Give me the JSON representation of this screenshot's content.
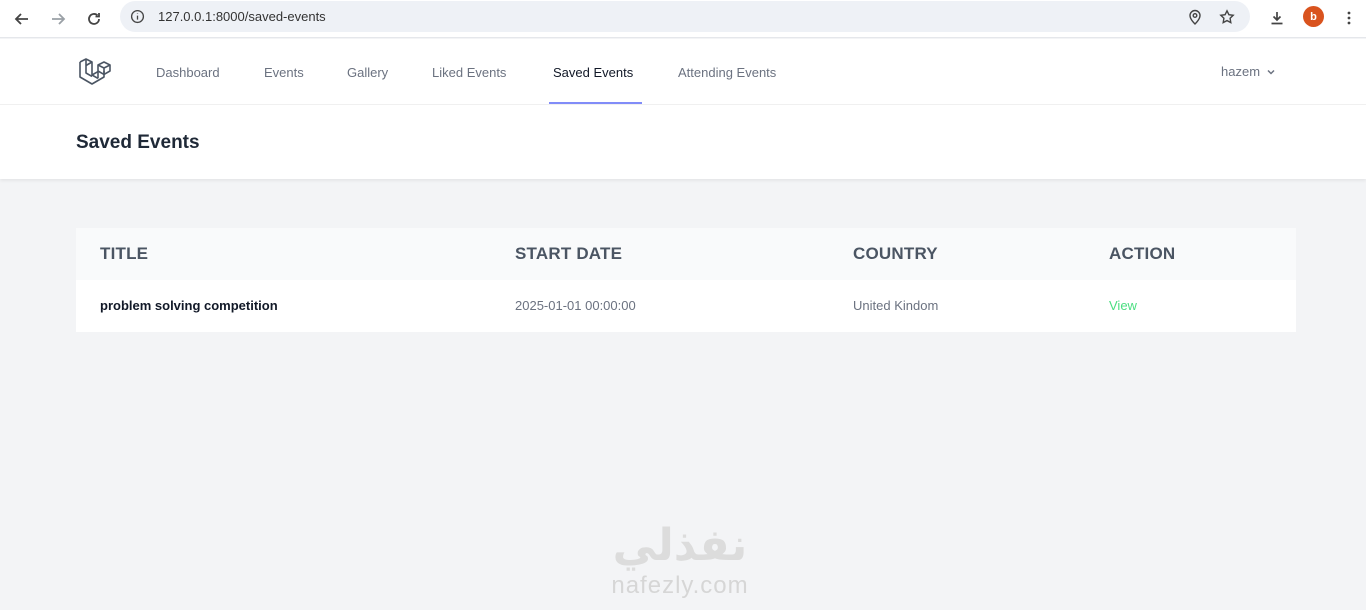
{
  "browser": {
    "url": "127.0.0.1:8000/saved-events",
    "profile_initial": "b"
  },
  "nav": {
    "links": [
      {
        "label": "Dashboard"
      },
      {
        "label": "Events"
      },
      {
        "label": "Gallery"
      },
      {
        "label": "Liked Events"
      },
      {
        "label": "Saved Events"
      },
      {
        "label": "Attending Events"
      }
    ],
    "active_index": 4,
    "user_name": "hazem",
    "accent_color": "#818cf8"
  },
  "page": {
    "title": "Saved Events"
  },
  "table": {
    "headers": [
      "TITLE",
      "START DATE",
      "COUNTRY",
      "ACTION"
    ],
    "rows": [
      {
        "title": "problem solving competition",
        "start_date": "2025-01-01 00:00:00",
        "country": "United Kindom",
        "action": "View"
      }
    ],
    "action_color": "#4ade80"
  },
  "watermark": {
    "arabic": "نفذلي",
    "latin": "nafezly.com"
  }
}
